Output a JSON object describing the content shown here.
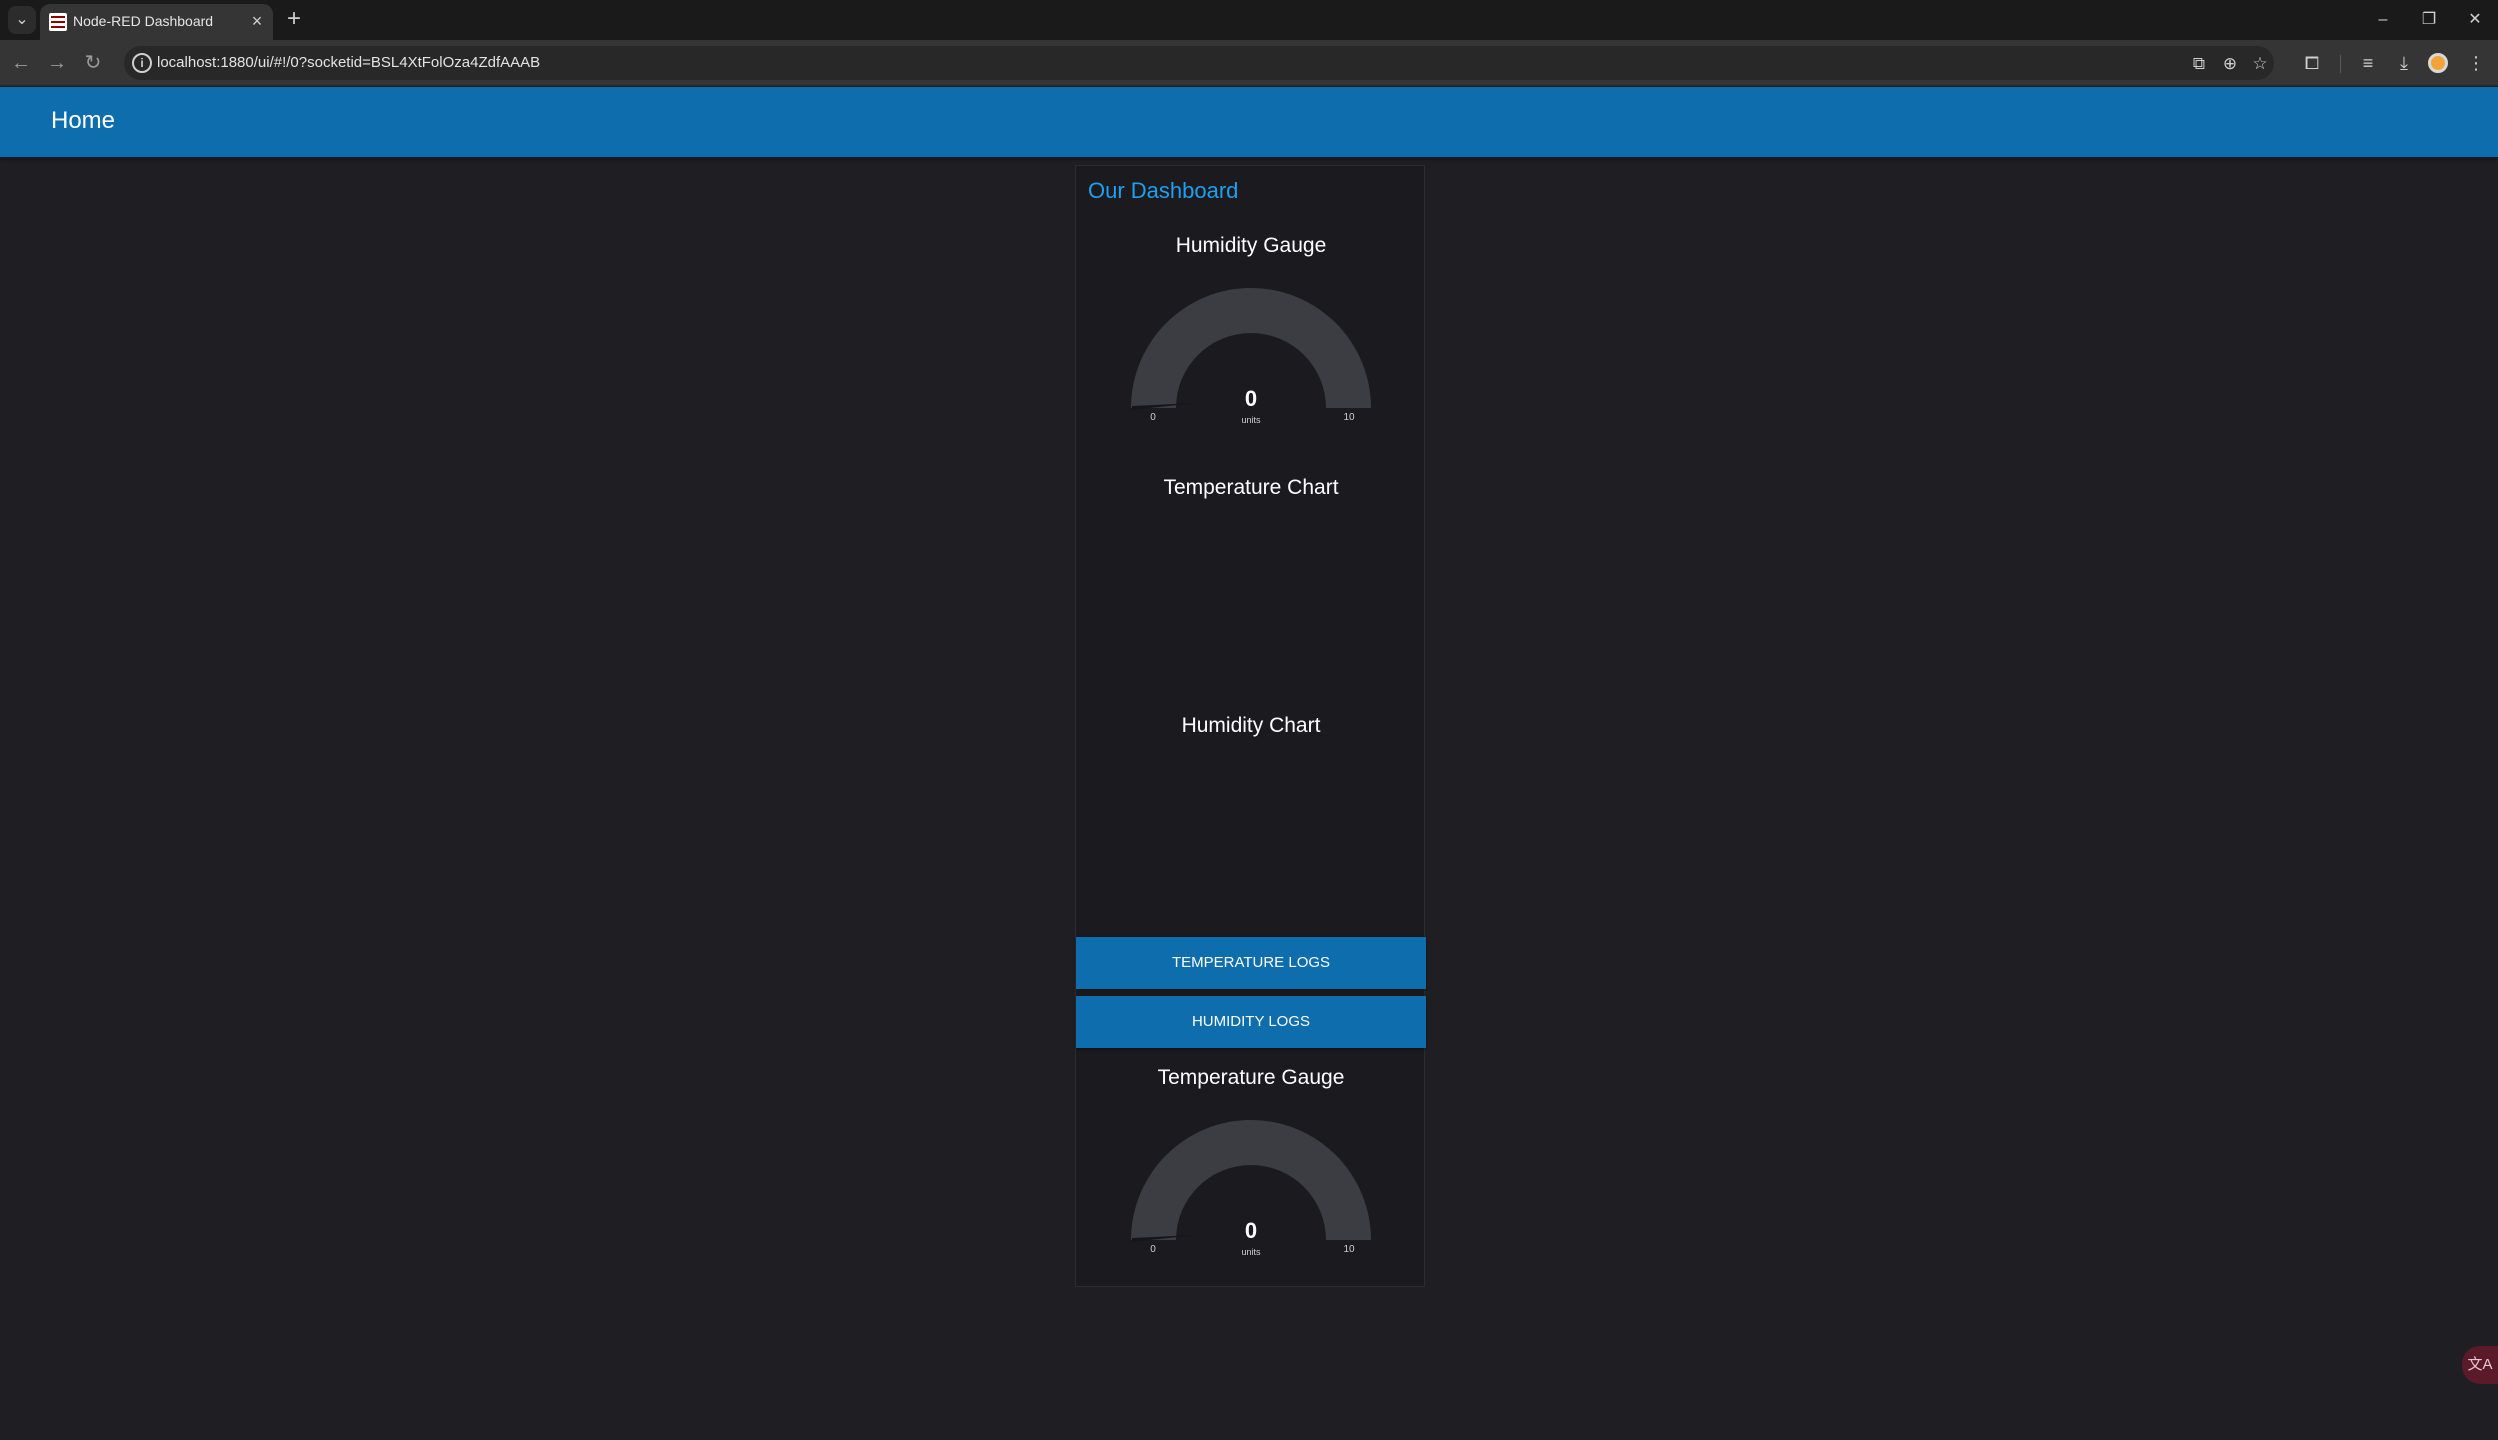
{
  "browser": {
    "tab_title": "Node-RED Dashboard",
    "tab_close": "×",
    "new_tab": "+",
    "tab_list": "⌄",
    "url": "localhost:1880/ui/#!/0?socketid=BSL4XtFolOza4ZdfAAAB",
    "info": "i",
    "nav": {
      "back": "←",
      "forward": "→",
      "reload": "↻"
    },
    "window": {
      "minimize": "–",
      "restore": "❐",
      "close": "✕"
    },
    "icons": {
      "install": "⧉",
      "zoom": "⊕",
      "bookmark": "☆",
      "extensions": "⧠",
      "media": "≡",
      "download": "⤓",
      "menu": "⋮"
    }
  },
  "header": {
    "title": "Home"
  },
  "group": {
    "title": "Our Dashboard",
    "humidity_gauge": {
      "title": "Humidity Gauge",
      "value": "0",
      "units": "units",
      "min": "0",
      "max": "10",
      "level": 0
    },
    "temperature_chart": {
      "title": "Temperature Chart"
    },
    "humidity_chart": {
      "title": "Humidity Chart"
    },
    "buttons": {
      "temperature_logs": "TEMPERATURE LOGS",
      "humidity_logs": "HUMIDITY LOGS"
    },
    "temperature_gauge": {
      "title": "Temperature Gauge",
      "value": "0",
      "units": "units",
      "min": "0",
      "max": "10",
      "level": 0
    }
  },
  "colors": {
    "accent": "#0e6dad",
    "group_title": "#1f9ff0",
    "background": "#1f1f23",
    "gauge_track": "#3b3d42"
  },
  "translate_badge": "文A"
}
